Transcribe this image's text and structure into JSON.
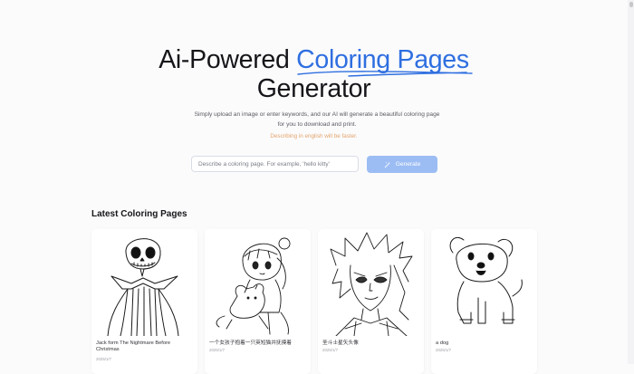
{
  "hero": {
    "title_prefix": "Ai-Powered ",
    "title_accent": "Coloring Pages",
    "title_line2": "Generator",
    "subtitle": "Simply upload an image or enter keywords, and our AI will generate a beautiful coloring page for you to download and print.",
    "hint": "Describing in english will be faster.",
    "accent_color": "#2f6fe0",
    "hint_color": "#e3a46b"
  },
  "search": {
    "placeholder": "Describe a coloring page. For example, 'hello kitty'",
    "value": ""
  },
  "generate": {
    "label": "Generate",
    "icon": "magic-wand-icon",
    "color": "#9cbdf4"
  },
  "latest": {
    "title": "Latest Coloring Pages",
    "cards": [
      {
        "title": "Jack form The Nightmare Before Christmas",
        "date": "2025/1/7",
        "image": "skeleton-jack-drawing"
      },
      {
        "title": "一个女孩子抱着一只英短猫并抚摸着",
        "date": "2025/1/7",
        "image": "girl-with-cat-drawing"
      },
      {
        "title": "圣斗士星矢头像",
        "date": "2025/1/7",
        "image": "anime-warrior-portrait-drawing"
      },
      {
        "title": "a dog",
        "date": "2025/1/7",
        "image": "puppy-drawing"
      }
    ]
  }
}
